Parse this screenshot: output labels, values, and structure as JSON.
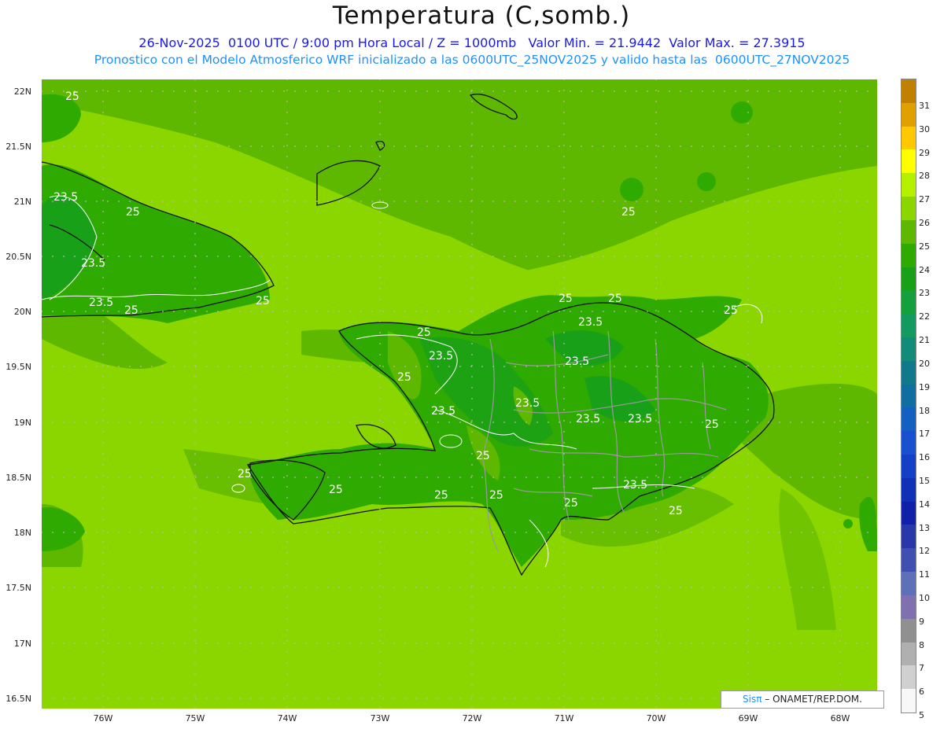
{
  "title": "Temperatura (C,somb.)",
  "subtitle1": "26-Nov-2025  0100 UTC / 9:00 pm Hora Local / Z = 1000mb   Valor Min. = 21.9442  Valor Max. = 27.3915",
  "subtitle2": "Pronostico con el Modelo Atmosferico WRF inicializado a las 0600UTC_25NOV2025 y valido hasta las  0600UTC_27NOV2025",
  "credit_logo": "Sisπ",
  "credit_text": "– ONAMET/REP.DOM.",
  "lat_labels": [
    "22N",
    "21.5N",
    "21N",
    "20.5N",
    "20N",
    "19.5N",
    "19N",
    "18.5N",
    "18N",
    "17.5N",
    "17N",
    "16.5N"
  ],
  "lon_labels": [
    "76W",
    "75W",
    "74W",
    "73W",
    "72W",
    "71W",
    "70W",
    "69W",
    "68W"
  ],
  "colorbar": {
    "labels": [
      "31",
      "30",
      "29",
      "28",
      "27",
      "26",
      "25",
      "24",
      "23",
      "22",
      "21",
      "20",
      "19",
      "18",
      "17",
      "16",
      "15",
      "14",
      "13",
      "12",
      "11",
      "10",
      "9",
      "8",
      "7",
      "6",
      "5"
    ],
    "colors": [
      "#c08000",
      "#e0a000",
      "#ffc800",
      "#ffff00",
      "#b4f000",
      "#8cd600",
      "#5fb800",
      "#2eaa00",
      "#18a018",
      "#14a03c",
      "#139a60",
      "#128c78",
      "#107a8c",
      "#106ea0",
      "#1460c0",
      "#1850d0",
      "#1440c8",
      "#1030b8",
      "#1020a8",
      "#2838a8",
      "#4050b0",
      "#6070b8",
      "#8070b0",
      "#909090",
      "#b0b0b0",
      "#d0d0d0",
      "#f8f8f8"
    ]
  },
  "contour_labels": [
    {
      "text": "25"
    },
    {
      "text": "23.5"
    },
    {
      "text": "25"
    },
    {
      "text": "23.5"
    },
    {
      "text": "23.5"
    },
    {
      "text": "25"
    },
    {
      "text": "25"
    },
    {
      "text": "25"
    },
    {
      "text": "23.5"
    },
    {
      "text": "25"
    },
    {
      "text": "23.5"
    },
    {
      "text": "23.5"
    },
    {
      "text": "25"
    },
    {
      "text": "23.5"
    },
    {
      "text": "25"
    },
    {
      "text": "25"
    },
    {
      "text": "25"
    },
    {
      "text": "23.5"
    },
    {
      "text": "25"
    },
    {
      "text": "23.5"
    },
    {
      "text": "23.5"
    },
    {
      "text": "25"
    },
    {
      "text": "25"
    },
    {
      "text": "25"
    },
    {
      "text": "25"
    },
    {
      "text": "25"
    },
    {
      "text": "25"
    },
    {
      "text": "25"
    },
    {
      "text": "23.5"
    }
  ]
}
